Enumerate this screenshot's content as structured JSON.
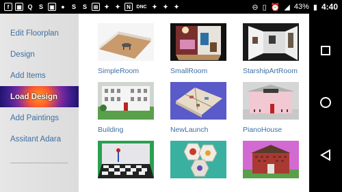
{
  "status_bar": {
    "battery": "43%",
    "time": "4:40",
    "notif_icons": [
      "f",
      "Q",
      "S",
      "▣",
      "S",
      "S",
      "⊞",
      "🐦",
      "🐦",
      "N",
      "DNC",
      "🐦",
      "🐦",
      "🐦"
    ]
  },
  "sidebar": {
    "items": [
      {
        "label": "Edit Floorplan",
        "active": false
      },
      {
        "label": "Design",
        "active": false
      },
      {
        "label": "Add Items",
        "active": false
      },
      {
        "label": "Load Design",
        "active": true
      },
      {
        "label": "Add Paintings",
        "active": false
      },
      {
        "label": "Assitant Adara",
        "active": false
      }
    ]
  },
  "designs": [
    {
      "label": "SimpleRoom"
    },
    {
      "label": "SmallRoom"
    },
    {
      "label": "StarshipArtRoom"
    },
    {
      "label": "Building"
    },
    {
      "label": "NewLaunch"
    },
    {
      "label": "PianoHouse"
    },
    {
      "label": ""
    },
    {
      "label": ""
    },
    {
      "label": ""
    }
  ],
  "colors": {
    "link": "#3d6fa3",
    "sidebar_bg": "#e0e0e0",
    "active_gradient": [
      "#ff9b2b",
      "#7b2aa0",
      "#1e1468"
    ]
  },
  "icons": {
    "nav_recent": "square-icon",
    "nav_home": "circle-icon",
    "nav_back": "triangle-back-icon"
  }
}
